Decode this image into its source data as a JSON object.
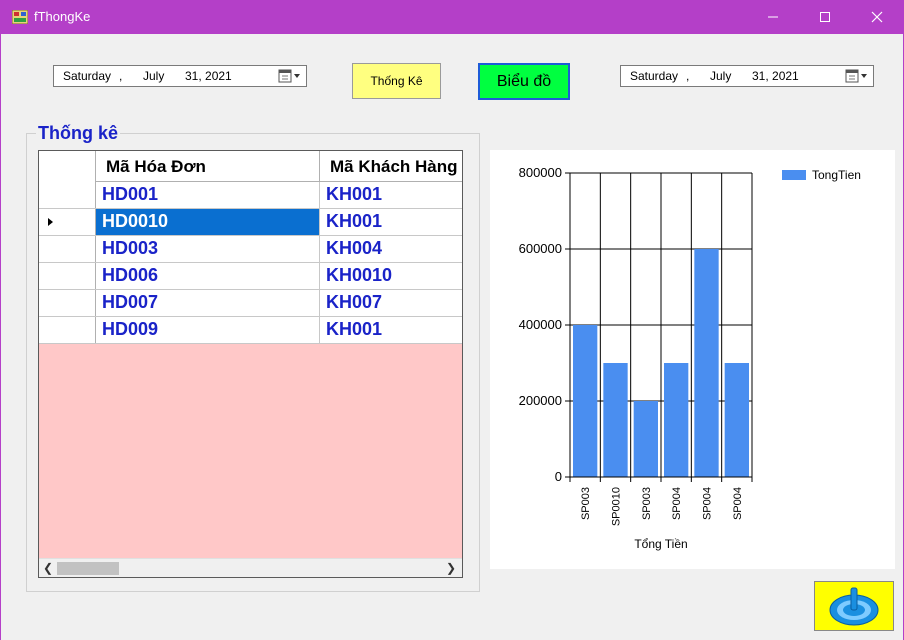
{
  "window": {
    "title": "fThongKe",
    "controls": {
      "minimize": "minimize-icon",
      "maximize": "maximize-icon",
      "close": "close-icon"
    },
    "accent": "#b43fc8"
  },
  "toolbar": {
    "date_from": {
      "weekday": "Saturday",
      "month": "July",
      "day_year": "31, 2021",
      "sep": ","
    },
    "date_to": {
      "weekday": "Saturday",
      "month": "July",
      "day_year": "31, 2021",
      "sep": ","
    },
    "thongke_label": "Thống Kê",
    "bieudo_label": "Biểu đồ"
  },
  "group": {
    "title": "Thống kê",
    "columns": [
      "Mã Hóa Đơn",
      "Mã Khách Hàng"
    ],
    "rows": [
      [
        "HD001",
        "KH001"
      ],
      [
        "HD0010",
        "KH001"
      ],
      [
        "HD003",
        "KH004"
      ],
      [
        "HD006",
        "KH0010"
      ],
      [
        "HD007",
        "KH007"
      ],
      [
        "HD009",
        "KH001"
      ]
    ],
    "selected_row": 1
  },
  "chart_data": {
    "type": "bar",
    "categories": [
      "SP003",
      "SP0010",
      "SP003",
      "SP004",
      "SP004",
      "SP004"
    ],
    "series": [
      {
        "name": "TongTien",
        "values": [
          400000,
          300000,
          200000,
          300000,
          600000,
          300000
        ],
        "color": "#4a8ef0"
      }
    ],
    "xlabel": "Tổng Tiền",
    "ylabel": "",
    "ylim": [
      0,
      800000
    ],
    "yticks": [
      "0",
      "200000",
      "400000",
      "600000",
      "800000"
    ],
    "grid": true,
    "legend": "top-right"
  },
  "power_button": {
    "icon": "power-icon"
  }
}
